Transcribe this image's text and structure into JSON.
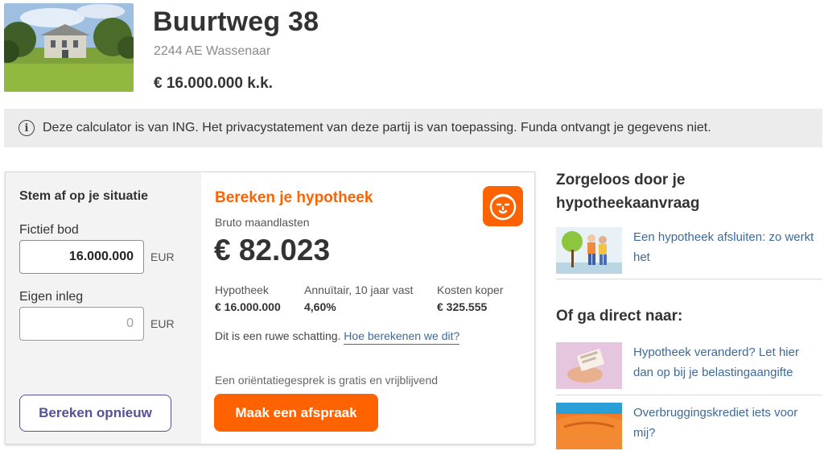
{
  "listing": {
    "address": "Buurtweg 38",
    "postal": "2244 AE Wassenaar",
    "price": "€ 16.000.000 k.k."
  },
  "notice": {
    "icon": "info-icon",
    "text": "Deze calculator is van ING. Het privacystatement van deze partij is van toepassing. Funda ontvangt je gegevens niet."
  },
  "situation": {
    "title": "Stem af op je situatie",
    "bid_label": "Fictief bod",
    "bid_value": "16.000.000",
    "bid_unit": "EUR",
    "equity_label": "Eigen inleg",
    "equity_placeholder": "0",
    "equity_unit": "EUR",
    "recalc_button": "Bereken opnieuw"
  },
  "calculation": {
    "title": "Bereken je hypotheek",
    "gross_label": "Bruto maandlasten",
    "gross_value": "€ 82.023",
    "columns": [
      {
        "label": "Hypotheek",
        "value": "€ 16.000.000"
      },
      {
        "label": "Annuïtair, 10 jaar vast",
        "value": "4,60%"
      },
      {
        "label": "Kosten koper",
        "value": "€ 325.555"
      }
    ],
    "estimate_text": "Dit is een ruwe schatting.",
    "estimate_link": "Hoe berekenen we dit?",
    "orientation_text": "Een oriëntatiegesprek is gratis en vrijblijvend",
    "cta_button": "Maak een afspraak",
    "brand_color": "#ff6200"
  },
  "sidebar": {
    "heading": "Zorgeloos door je hypotheekaanvraag",
    "article": "Een hypotheek afsluiten: zo werkt het",
    "direct_heading": "Of ga direct naar:",
    "links": [
      "Hypotheek veranderd? Let hier dan op bij je belastingaangifte",
      "Overbruggingskrediet iets voor mij?"
    ]
  }
}
